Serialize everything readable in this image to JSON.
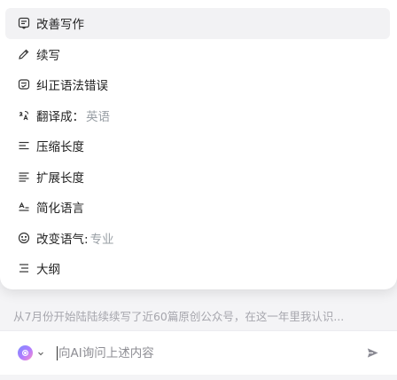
{
  "menu": {
    "items": [
      {
        "icon": "edit-doc-icon",
        "label": "改善写作",
        "value": ""
      },
      {
        "icon": "pencil-icon",
        "label": "续写",
        "value": ""
      },
      {
        "icon": "spellcheck-icon",
        "label": "纠正语法错误",
        "value": ""
      },
      {
        "icon": "translate-icon",
        "label": "翻译成：",
        "value": "英语"
      },
      {
        "icon": "compress-lines-icon",
        "label": "压缩长度",
        "value": ""
      },
      {
        "icon": "expand-lines-icon",
        "label": "扩展长度",
        "value": ""
      },
      {
        "icon": "simplify-icon",
        "label": "简化语言",
        "value": ""
      },
      {
        "icon": "smiley-icon",
        "label": "改变语气:",
        "value": "专业"
      },
      {
        "icon": "outline-icon",
        "label": "大纲",
        "value": ""
      }
    ]
  },
  "preview": {
    "text": "从7月份开始陆陆续续写了近60篇原创公众号，在这一年里我认识..."
  },
  "input": {
    "placeholder": "向AI询问上述内容",
    "value": ""
  },
  "colors": {
    "accent": "#8e7cff",
    "muted": "#9aa0a6"
  }
}
